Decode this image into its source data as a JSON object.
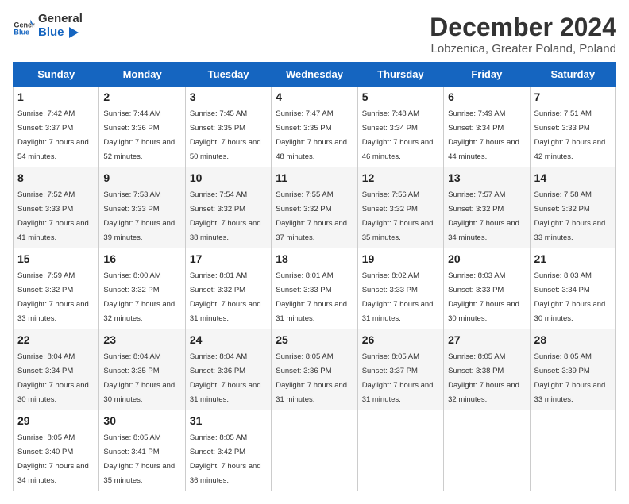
{
  "header": {
    "logo_general": "General",
    "logo_blue": "Blue",
    "title": "December 2024",
    "subtitle": "Lobzenica, Greater Poland, Poland"
  },
  "weekdays": [
    "Sunday",
    "Monday",
    "Tuesday",
    "Wednesday",
    "Thursday",
    "Friday",
    "Saturday"
  ],
  "weeks": [
    [
      {
        "day": "1",
        "sunrise": "Sunrise: 7:42 AM",
        "sunset": "Sunset: 3:37 PM",
        "daylight": "Daylight: 7 hours and 54 minutes."
      },
      {
        "day": "2",
        "sunrise": "Sunrise: 7:44 AM",
        "sunset": "Sunset: 3:36 PM",
        "daylight": "Daylight: 7 hours and 52 minutes."
      },
      {
        "day": "3",
        "sunrise": "Sunrise: 7:45 AM",
        "sunset": "Sunset: 3:35 PM",
        "daylight": "Daylight: 7 hours and 50 minutes."
      },
      {
        "day": "4",
        "sunrise": "Sunrise: 7:47 AM",
        "sunset": "Sunset: 3:35 PM",
        "daylight": "Daylight: 7 hours and 48 minutes."
      },
      {
        "day": "5",
        "sunrise": "Sunrise: 7:48 AM",
        "sunset": "Sunset: 3:34 PM",
        "daylight": "Daylight: 7 hours and 46 minutes."
      },
      {
        "day": "6",
        "sunrise": "Sunrise: 7:49 AM",
        "sunset": "Sunset: 3:34 PM",
        "daylight": "Daylight: 7 hours and 44 minutes."
      },
      {
        "day": "7",
        "sunrise": "Sunrise: 7:51 AM",
        "sunset": "Sunset: 3:33 PM",
        "daylight": "Daylight: 7 hours and 42 minutes."
      }
    ],
    [
      {
        "day": "8",
        "sunrise": "Sunrise: 7:52 AM",
        "sunset": "Sunset: 3:33 PM",
        "daylight": "Daylight: 7 hours and 41 minutes."
      },
      {
        "day": "9",
        "sunrise": "Sunrise: 7:53 AM",
        "sunset": "Sunset: 3:33 PM",
        "daylight": "Daylight: 7 hours and 39 minutes."
      },
      {
        "day": "10",
        "sunrise": "Sunrise: 7:54 AM",
        "sunset": "Sunset: 3:32 PM",
        "daylight": "Daylight: 7 hours and 38 minutes."
      },
      {
        "day": "11",
        "sunrise": "Sunrise: 7:55 AM",
        "sunset": "Sunset: 3:32 PM",
        "daylight": "Daylight: 7 hours and 37 minutes."
      },
      {
        "day": "12",
        "sunrise": "Sunrise: 7:56 AM",
        "sunset": "Sunset: 3:32 PM",
        "daylight": "Daylight: 7 hours and 35 minutes."
      },
      {
        "day": "13",
        "sunrise": "Sunrise: 7:57 AM",
        "sunset": "Sunset: 3:32 PM",
        "daylight": "Daylight: 7 hours and 34 minutes."
      },
      {
        "day": "14",
        "sunrise": "Sunrise: 7:58 AM",
        "sunset": "Sunset: 3:32 PM",
        "daylight": "Daylight: 7 hours and 33 minutes."
      }
    ],
    [
      {
        "day": "15",
        "sunrise": "Sunrise: 7:59 AM",
        "sunset": "Sunset: 3:32 PM",
        "daylight": "Daylight: 7 hours and 33 minutes."
      },
      {
        "day": "16",
        "sunrise": "Sunrise: 8:00 AM",
        "sunset": "Sunset: 3:32 PM",
        "daylight": "Daylight: 7 hours and 32 minutes."
      },
      {
        "day": "17",
        "sunrise": "Sunrise: 8:01 AM",
        "sunset": "Sunset: 3:32 PM",
        "daylight": "Daylight: 7 hours and 31 minutes."
      },
      {
        "day": "18",
        "sunrise": "Sunrise: 8:01 AM",
        "sunset": "Sunset: 3:33 PM",
        "daylight": "Daylight: 7 hours and 31 minutes."
      },
      {
        "day": "19",
        "sunrise": "Sunrise: 8:02 AM",
        "sunset": "Sunset: 3:33 PM",
        "daylight": "Daylight: 7 hours and 31 minutes."
      },
      {
        "day": "20",
        "sunrise": "Sunrise: 8:03 AM",
        "sunset": "Sunset: 3:33 PM",
        "daylight": "Daylight: 7 hours and 30 minutes."
      },
      {
        "day": "21",
        "sunrise": "Sunrise: 8:03 AM",
        "sunset": "Sunset: 3:34 PM",
        "daylight": "Daylight: 7 hours and 30 minutes."
      }
    ],
    [
      {
        "day": "22",
        "sunrise": "Sunrise: 8:04 AM",
        "sunset": "Sunset: 3:34 PM",
        "daylight": "Daylight: 7 hours and 30 minutes."
      },
      {
        "day": "23",
        "sunrise": "Sunrise: 8:04 AM",
        "sunset": "Sunset: 3:35 PM",
        "daylight": "Daylight: 7 hours and 30 minutes."
      },
      {
        "day": "24",
        "sunrise": "Sunrise: 8:04 AM",
        "sunset": "Sunset: 3:36 PM",
        "daylight": "Daylight: 7 hours and 31 minutes."
      },
      {
        "day": "25",
        "sunrise": "Sunrise: 8:05 AM",
        "sunset": "Sunset: 3:36 PM",
        "daylight": "Daylight: 7 hours and 31 minutes."
      },
      {
        "day": "26",
        "sunrise": "Sunrise: 8:05 AM",
        "sunset": "Sunset: 3:37 PM",
        "daylight": "Daylight: 7 hours and 31 minutes."
      },
      {
        "day": "27",
        "sunrise": "Sunrise: 8:05 AM",
        "sunset": "Sunset: 3:38 PM",
        "daylight": "Daylight: 7 hours and 32 minutes."
      },
      {
        "day": "28",
        "sunrise": "Sunrise: 8:05 AM",
        "sunset": "Sunset: 3:39 PM",
        "daylight": "Daylight: 7 hours and 33 minutes."
      }
    ],
    [
      {
        "day": "29",
        "sunrise": "Sunrise: 8:05 AM",
        "sunset": "Sunset: 3:40 PM",
        "daylight": "Daylight: 7 hours and 34 minutes."
      },
      {
        "day": "30",
        "sunrise": "Sunrise: 8:05 AM",
        "sunset": "Sunset: 3:41 PM",
        "daylight": "Daylight: 7 hours and 35 minutes."
      },
      {
        "day": "31",
        "sunrise": "Sunrise: 8:05 AM",
        "sunset": "Sunset: 3:42 PM",
        "daylight": "Daylight: 7 hours and 36 minutes."
      },
      null,
      null,
      null,
      null
    ]
  ]
}
